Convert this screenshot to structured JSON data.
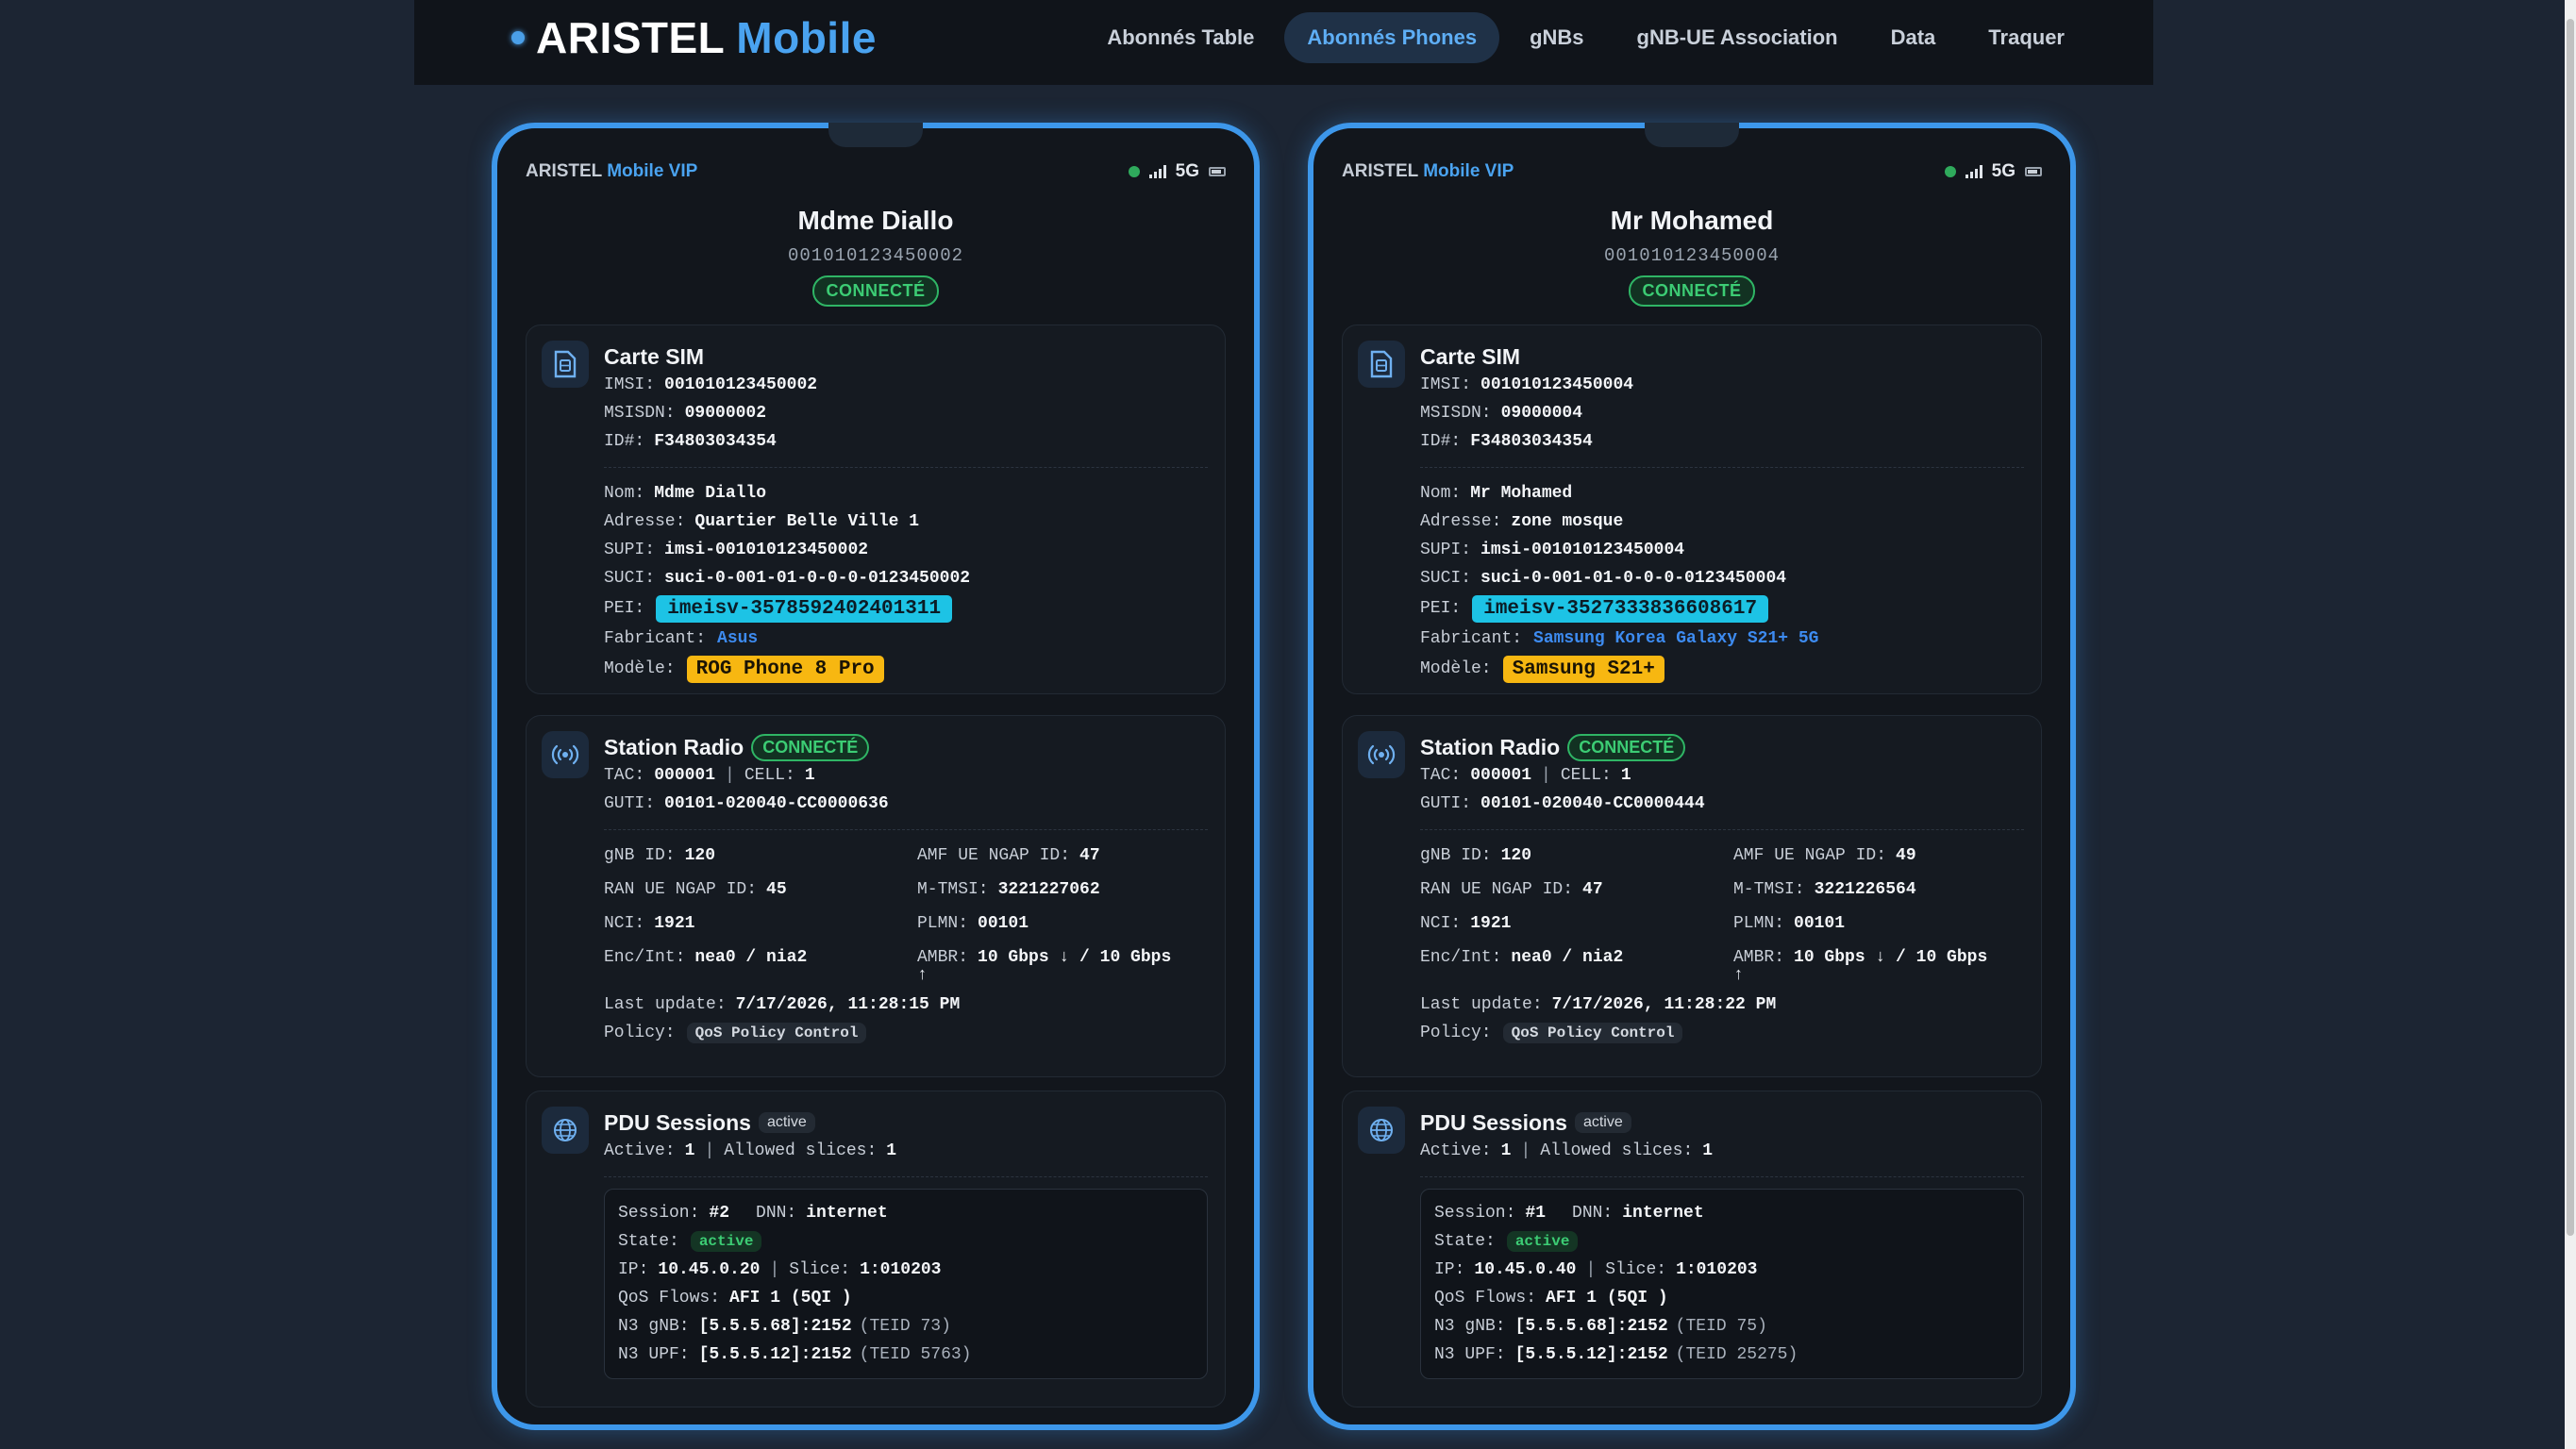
{
  "nav": {
    "brand_main": "ARISTEL",
    "brand_accent": "Mobile",
    "links": [
      "Abonnés Table",
      "Abonnés Phones",
      "gNBs",
      "gNB-UE Association",
      "Data",
      "Traquer"
    ],
    "active": "Abonnés Phones"
  },
  "colors": {
    "accent": "#3d97ea",
    "connected": "#3ccc74",
    "pei_chip": "#1dc3e5",
    "model_chip": "#f7b711"
  },
  "phones": [
    {
      "carrier": "ARISTEL",
      "carrier_accent": "Mobile VIP",
      "network": "5G",
      "name": "Mdme Diallo",
      "imsi_top": "001010123450002",
      "status": "CONNECTÉ",
      "sim": {
        "title": "Carte SIM",
        "imsi_label": "IMSI:",
        "imsi": "001010123450002",
        "msisdn_label": "MSISDN:",
        "msisdn": "09000002",
        "id_label": "ID#:",
        "id": "F34803034354",
        "nom_label": "Nom:",
        "nom": "Mdme Diallo",
        "adresse_label": "Adresse:",
        "adresse": "Quartier Belle Ville 1",
        "supi_label": "SUPI:",
        "supi": "imsi-001010123450002",
        "suci_label": "SUCI:",
        "suci": "suci-0-001-01-0-0-0-0123450002",
        "pei_label": "PEI:",
        "pei": "imeisv-3578592402401311",
        "fabricant_label": "Fabricant:",
        "fabricant": "Asus",
        "modele_label": "Modèle:",
        "modele": "ROG Phone 8 Pro"
      },
      "radio": {
        "title": "Station Radio",
        "status": "CONNECTÉ",
        "tac_label": "TAC:",
        "tac": "000001",
        "cell_label": "CELL:",
        "cell": "1",
        "guti_label": "GUTI:",
        "guti": "00101-020040-CC0000636",
        "gnb_id_label": "gNB ID:",
        "gnb_id": "120",
        "amf_label": "AMF UE NGAP ID:",
        "amf": "47",
        "ran_label": "RAN UE NGAP ID:",
        "ran": "45",
        "mtmsi_label": "M-TMSI:",
        "mtmsi": "3221227062",
        "nci_label": "NCI:",
        "nci": "1921",
        "plmn_label": "PLMN:",
        "plmn": "00101",
        "enc_label": "Enc/Int:",
        "enc": "nea0 / nia2",
        "ambr_label": "AMBR:",
        "ambr": "10 Gbps ↓ / 10 Gbps",
        "ambr_arrow": "↑",
        "update_label": "Last update:",
        "update": "7/17/2026, 11:28:15 PM",
        "policy_label": "Policy:",
        "policy": "QoS Policy Control"
      },
      "pdu": {
        "title": "PDU Sessions",
        "badge": "active",
        "active_label": "Active:",
        "active": "1",
        "slices_label": "Allowed slices:",
        "slices": "1",
        "session_label": "Session:",
        "session": "#2",
        "dnn_label": "DNN:",
        "dnn": "internet",
        "state_label": "State:",
        "state": "active",
        "ip_label": "IP:",
        "ip": "10.45.0.20",
        "slice_label": "Slice:",
        "slice": "1:010203",
        "qos_label": "QoS Flows:",
        "qos": "AFI 1 (5QI )",
        "n3gnb_label": "N3 gNB:",
        "n3gnb": "[5.5.5.68]:2152",
        "n3gnb_teid": "(TEID 73)",
        "n3upf_label": "N3 UPF:",
        "n3upf": "[5.5.5.12]:2152",
        "n3upf_teid": "(TEID 5763)"
      }
    },
    {
      "carrier": "ARISTEL",
      "carrier_accent": "Mobile VIP",
      "network": "5G",
      "name": "Mr Mohamed",
      "imsi_top": "001010123450004",
      "status": "CONNECTÉ",
      "sim": {
        "title": "Carte SIM",
        "imsi_label": "IMSI:",
        "imsi": "001010123450004",
        "msisdn_label": "MSISDN:",
        "msisdn": "09000004",
        "id_label": "ID#:",
        "id": "F34803034354",
        "nom_label": "Nom:",
        "nom": "Mr Mohamed",
        "adresse_label": "Adresse:",
        "adresse": "zone mosque",
        "supi_label": "SUPI:",
        "supi": "imsi-001010123450004",
        "suci_label": "SUCI:",
        "suci": "suci-0-001-01-0-0-0-0123450004",
        "pei_label": "PEI:",
        "pei": "imeisv-3527333836608617",
        "fabricant_label": "Fabricant:",
        "fabricant": "Samsung Korea Galaxy S21+ 5G",
        "modele_label": "Modèle:",
        "modele": "Samsung S21+"
      },
      "radio": {
        "title": "Station Radio",
        "status": "CONNECTÉ",
        "tac_label": "TAC:",
        "tac": "000001",
        "cell_label": "CELL:",
        "cell": "1",
        "guti_label": "GUTI:",
        "guti": "00101-020040-CC0000444",
        "gnb_id_label": "gNB ID:",
        "gnb_id": "120",
        "amf_label": "AMF UE NGAP ID:",
        "amf": "49",
        "ran_label": "RAN UE NGAP ID:",
        "ran": "47",
        "mtmsi_label": "M-TMSI:",
        "mtmsi": "3221226564",
        "nci_label": "NCI:",
        "nci": "1921",
        "plmn_label": "PLMN:",
        "plmn": "00101",
        "enc_label": "Enc/Int:",
        "enc": "nea0 / nia2",
        "ambr_label": "AMBR:",
        "ambr": "10 Gbps ↓ / 10 Gbps",
        "ambr_arrow": "↑",
        "update_label": "Last update:",
        "update": "7/17/2026, 11:28:22 PM",
        "policy_label": "Policy:",
        "policy": "QoS Policy Control"
      },
      "pdu": {
        "title": "PDU Sessions",
        "badge": "active",
        "active_label": "Active:",
        "active": "1",
        "slices_label": "Allowed slices:",
        "slices": "1",
        "session_label": "Session:",
        "session": "#1",
        "dnn_label": "DNN:",
        "dnn": "internet",
        "state_label": "State:",
        "state": "active",
        "ip_label": "IP:",
        "ip": "10.45.0.40",
        "slice_label": "Slice:",
        "slice": "1:010203",
        "qos_label": "QoS Flows:",
        "qos": "AFI 1 (5QI )",
        "n3gnb_label": "N3 gNB:",
        "n3gnb": "[5.5.5.68]:2152",
        "n3gnb_teid": "(TEID 75)",
        "n3upf_label": "N3 UPF:",
        "n3upf": "[5.5.5.12]:2152",
        "n3upf_teid": "(TEID 25275)"
      }
    }
  ]
}
